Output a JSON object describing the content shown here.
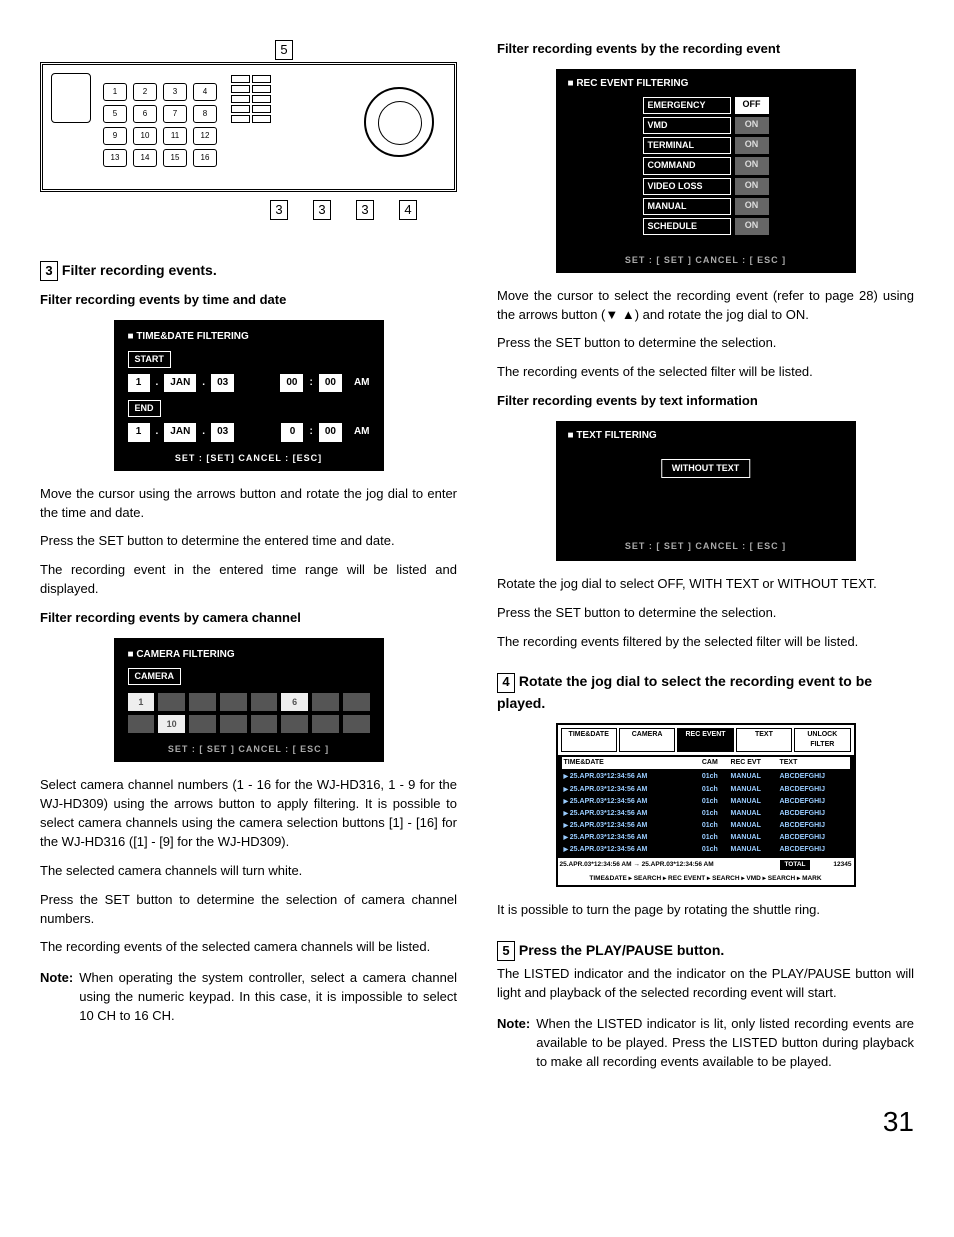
{
  "page_number": "31",
  "left": {
    "callout_top": "5",
    "callouts_bottom": [
      "3",
      "3",
      "3",
      "4"
    ],
    "step3": {
      "num": "3",
      "head": "Filter recording events.",
      "sub1": "Filter recording events by time and date",
      "panel_td": {
        "title": "TIME&DATE FILTERING",
        "start_tab": "START",
        "end_tab": "END",
        "start": {
          "d": "1",
          "m": "JAN",
          "y": "03",
          "h": "00",
          "mm": "00",
          "ap": "AM"
        },
        "end": {
          "d": "1",
          "m": "JAN",
          "y": "03",
          "h": "0",
          "mm": "00",
          "ap": "AM"
        },
        "footer": "SET : [SET]  CANCEL : [ESC]"
      },
      "p1": "Move the cursor using the arrows button and rotate the jog dial to enter the time and date.",
      "p2": "Press the SET button to determine the entered time and date.",
      "p3": "The recording event in the entered time range will be listed and displayed.",
      "sub2": "Filter recording events by camera channel",
      "panel_cam": {
        "title": "CAMERA FILTERING",
        "tab": "CAMERA",
        "on_a": "1",
        "on_b": "6",
        "on_c": "10",
        "footer": "SET : [ SET ]     CANCEL : [ ESC ]"
      },
      "p4": "Select camera channel numbers (1 - 16 for the WJ-HD316, 1 - 9 for the WJ-HD309) using the arrows button to apply filtering. It is possible to select camera channels using the camera selection buttons [1] - [16] for the WJ-HD316 ([1] - [9] for the WJ-HD309).",
      "p5": "The selected camera channels will turn white.",
      "p6": "Press the SET button to determine the selection of camera channel numbers.",
      "p7": "The recording events of the selected camera channels will be listed.",
      "note_label": "Note:",
      "note_body": "When operating the system controller, select a camera channel using the numeric keypad. In this case, it is impossible to select 10 CH to 16 CH."
    }
  },
  "right": {
    "sub1": "Filter recording events by the recording event",
    "panel_rec": {
      "title": "REC EVENT FILTERING",
      "rows": [
        {
          "label": "EMERGENCY",
          "val": "OFF",
          "off": true
        },
        {
          "label": "VMD",
          "val": "ON",
          "off": false
        },
        {
          "label": "TERMINAL",
          "val": "ON",
          "off": false
        },
        {
          "label": "COMMAND",
          "val": "ON",
          "off": false
        },
        {
          "label": "VIDEO LOSS",
          "val": "ON",
          "off": false
        },
        {
          "label": "MANUAL",
          "val": "ON",
          "off": false
        },
        {
          "label": "SCHEDULE",
          "val": "ON",
          "off": false
        }
      ],
      "footer": "SET : [ SET ]     CANCEL : [ ESC ]"
    },
    "p1": "Move the cursor to select the recording event (refer to page 28) using the arrows button (▼ ▲) and rotate the jog dial to ON.",
    "p2": "Press the SET button to determine the selection.",
    "p3": "The recording events of the selected filter will be listed.",
    "sub2": "Filter recording events by text information",
    "panel_text": {
      "title": "TEXT FILTERING",
      "value": "WITHOUT TEXT",
      "footer": "SET : [ SET ]     CANCEL : [ ESC ]"
    },
    "p4": "Rotate the jog dial to select OFF, WITH TEXT or WITHOUT TEXT.",
    "p5": "Press the SET button to determine the selection.",
    "p6": "The recording events filtered by the selected filter will be listed.",
    "step4": {
      "num": "4",
      "head_a": "Rotate the jog dial to select ",
      "head_b": "the recording event to be played."
    },
    "panel_list": {
      "tabs": [
        "TIME&DATE",
        "CAMERA",
        "REC EVENT",
        "TEXT",
        "UNLOCK FILTER"
      ],
      "head": {
        "td": "TIME&DATE",
        "cam": "CAM",
        "evt": "REC EVT",
        "txt": "TEXT"
      },
      "row": {
        "td": "25.APR.03*12:34:56 AM",
        "cam": "01ch",
        "evt": "MANUAL",
        "txt": "ABCDEFGHIJ"
      },
      "range": "25.APR.03*12:34:56 AM → 25.APR.03*12:34:56 AM",
      "total_label": "TOTAL",
      "total_val": "12345",
      "bottom": "TIME&DATE ▸ SEARCH ▸ REC EVENT ▸ SEARCH ▸ VMD ▸ SEARCH ▸ MARK"
    },
    "p7": "It is possible to turn the page by rotating the shuttle ring.",
    "step5": {
      "num": "5",
      "head": "Press the PLAY/PAUSE button."
    },
    "p8": "The LISTED indicator and the indicator on the PLAY/PAUSE button will light and playback of the selected recording event will start.",
    "note_label": "Note:",
    "note_body": "When the LISTED indicator is lit, only listed recording events are available to be played. Press the LISTED button during playback to make all recording events available to be played."
  }
}
